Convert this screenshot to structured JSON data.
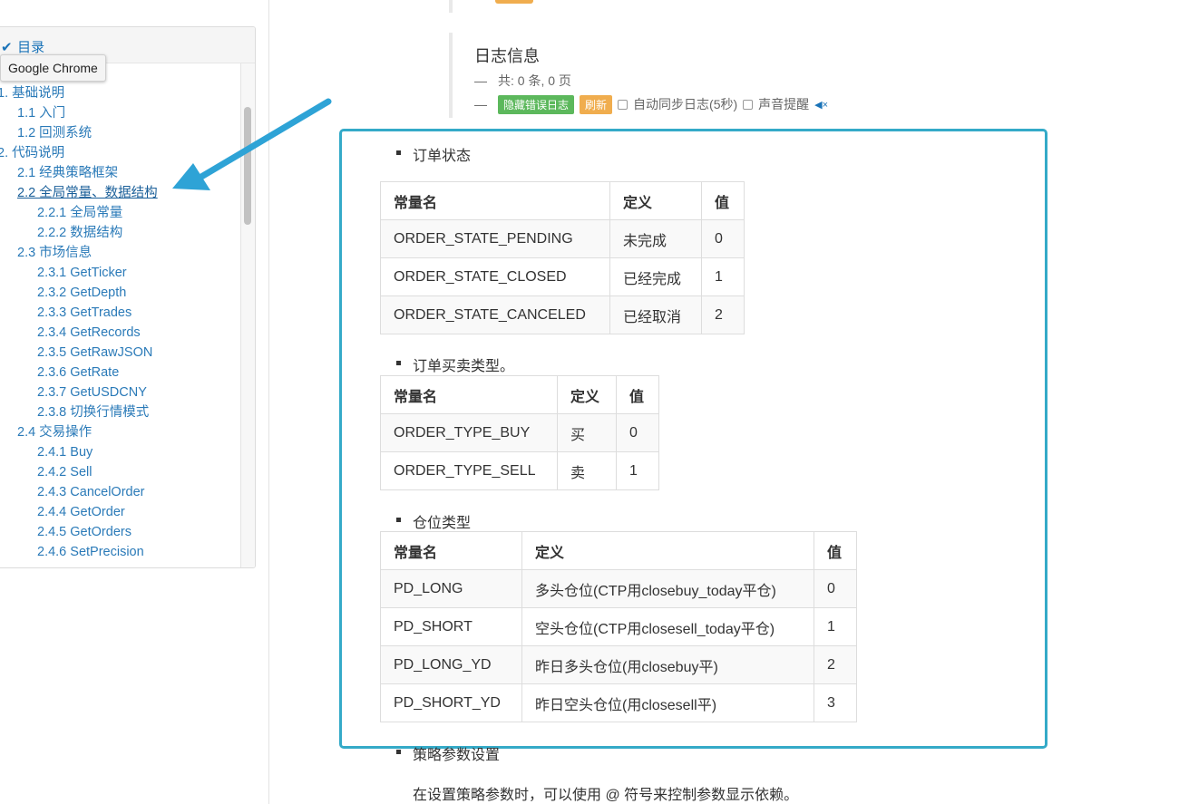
{
  "toc": {
    "title": "目录",
    "tooltip": "Google Chrome",
    "items": [
      {
        "label": "1. 基础说明",
        "level": 1
      },
      {
        "label": "1.1 入门",
        "level": 2
      },
      {
        "label": "1.2 回测系统",
        "level": 2
      },
      {
        "label": "2. 代码说明",
        "level": 1
      },
      {
        "label": "2.1 经典策略框架",
        "level": 2
      },
      {
        "label": "2.2 全局常量、数据结构",
        "level": 2,
        "active": true
      },
      {
        "label": "2.2.1 全局常量",
        "level": 3
      },
      {
        "label": "2.2.2 数据结构",
        "level": 3
      },
      {
        "label": "2.3 市场信息",
        "level": 2
      },
      {
        "label": "2.3.1 GetTicker",
        "level": 3
      },
      {
        "label": "2.3.2 GetDepth",
        "level": 3
      },
      {
        "label": "2.3.3 GetTrades",
        "level": 3
      },
      {
        "label": "2.3.4 GetRecords",
        "level": 3
      },
      {
        "label": "2.3.5 GetRawJSON",
        "level": 3
      },
      {
        "label": "2.3.6 GetRate",
        "level": 3
      },
      {
        "label": "2.3.7 GetUSDCNY",
        "level": 3
      },
      {
        "label": "2.3.8 切换行情模式",
        "level": 3
      },
      {
        "label": "2.4 交易操作",
        "level": 2
      },
      {
        "label": "2.4.1 Buy",
        "level": 3
      },
      {
        "label": "2.4.2 Sell",
        "level": 3
      },
      {
        "label": "2.4.3 CancelOrder",
        "level": 3
      },
      {
        "label": "2.4.4 GetOrder",
        "level": 3
      },
      {
        "label": "2.4.5 GetOrders",
        "level": 3
      },
      {
        "label": "2.4.6 SetPrecision",
        "level": 3
      }
    ]
  },
  "log": {
    "title": "日志信息",
    "summary": "共: 0 条, 0 页",
    "hide_errors_label": "隐藏错误日志",
    "refresh_label": "刷新",
    "auto_sync_label": "自动同步日志(5秒)",
    "sound_label": "声音提醒"
  },
  "sections": {
    "order_state": {
      "heading": "订单状态",
      "headers": [
        "常量名",
        "定义",
        "值"
      ],
      "rows": [
        [
          "ORDER_STATE_PENDING",
          "未完成",
          "0"
        ],
        [
          "ORDER_STATE_CLOSED",
          "已经完成",
          "1"
        ],
        [
          "ORDER_STATE_CANCELED",
          "已经取消",
          "2"
        ]
      ]
    },
    "order_type": {
      "heading": "订单买卖类型。",
      "headers": [
        "常量名",
        "定义",
        "值"
      ],
      "rows": [
        [
          "ORDER_TYPE_BUY",
          "买",
          "0"
        ],
        [
          "ORDER_TYPE_SELL",
          "卖",
          "1"
        ]
      ]
    },
    "position_type": {
      "heading": "仓位类型",
      "headers": [
        "常量名",
        "定义",
        "值"
      ],
      "rows": [
        [
          "PD_LONG",
          "多头仓位(CTP用closebuy_today平仓)",
          "0"
        ],
        [
          "PD_SHORT",
          "空头仓位(CTP用closesell_today平仓)",
          "1"
        ],
        [
          "PD_LONG_YD",
          "昨日多头仓位(用closebuy平)",
          "2"
        ],
        [
          "PD_SHORT_YD",
          "昨日空头仓位(用closesell平)",
          "3"
        ]
      ]
    },
    "strategy_params": {
      "heading": "策略参数设置",
      "text": "在设置策略参数时，可以使用 @ 符号来控制参数显示依赖。"
    }
  },
  "colors": {
    "link": "#2a7ab8",
    "highlight_border": "#34aac8",
    "arrow": "#2ea3d6",
    "green_button": "#5cb85c",
    "orange_button": "#f0ad4e"
  },
  "icons": [
    "check-icon",
    "speaker-mute-icon",
    "arrow-annotation"
  ]
}
